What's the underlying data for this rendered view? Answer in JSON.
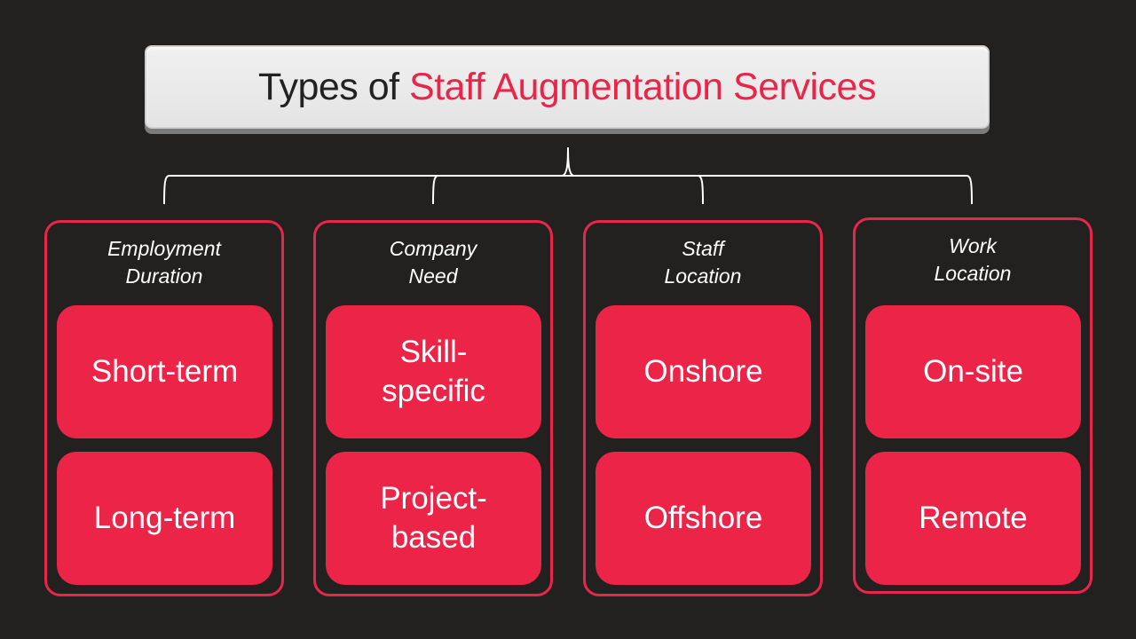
{
  "title": {
    "prefix": "Types of",
    "highlight": "Staff Augmentation Services"
  },
  "colors": {
    "background": "#222120",
    "accent": "#ec2548",
    "title_box": "#e6e6e6"
  },
  "categories": [
    {
      "heading_line1": "Employment",
      "heading_line2": "Duration",
      "items": [
        "Short-term",
        "Long-term"
      ]
    },
    {
      "heading_line1": "Company",
      "heading_line2": "Need",
      "items": [
        "Skill-\nspecific",
        "Project-\nbased"
      ]
    },
    {
      "heading_line1": "Staff",
      "heading_line2": "Location",
      "items": [
        "Onshore",
        "Offshore"
      ]
    },
    {
      "heading_line1": "Work",
      "heading_line2": "Location",
      "items": [
        "On-site",
        "Remote"
      ]
    }
  ]
}
